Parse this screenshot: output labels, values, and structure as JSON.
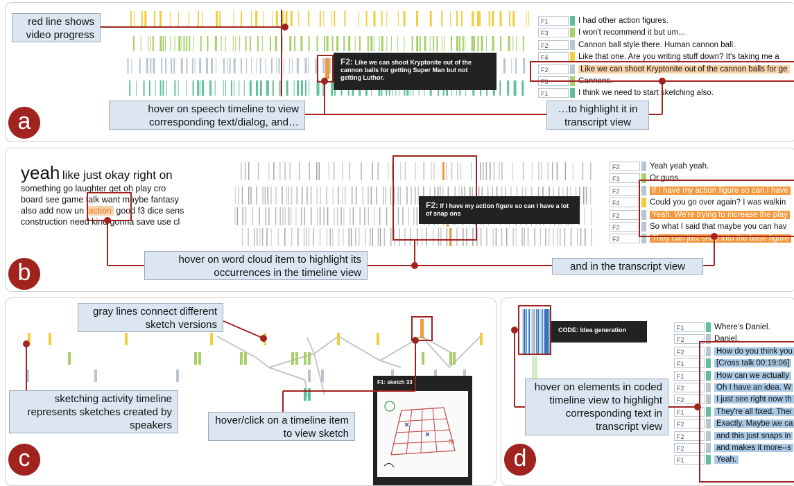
{
  "panel_a": {
    "badge": "a",
    "callout_progress": "red line shows video progress",
    "tooltip_speaker": "F2:",
    "tooltip_text": "Like we can shoot Kryptonite out of the cannon balls for getting Super Man but not getting Luthor.",
    "callout_hover": "hover on speech timeline to view corresponding text/dialog, and…",
    "callout_highlight": "…to highlight it in transcript view",
    "transcript": [
      {
        "speaker": "F1",
        "text": "I had other action figures."
      },
      {
        "speaker": "F3",
        "text": "I won't recommend it but um..."
      },
      {
        "speaker": "F2",
        "text": "Cannon ball style there. Human cannon ball."
      },
      {
        "speaker": "F4",
        "text": "Like that one. Are you writing stuff down? It's taking me a"
      },
      {
        "speaker": "F2",
        "text": "Like we can shoot Kryptonite out of the cannon balls for ge"
      },
      {
        "speaker": "F3",
        "text": "Cannons."
      },
      {
        "speaker": "F1",
        "text": "I think we need to start sketching also."
      }
    ]
  },
  "panel_b": {
    "badge": "b",
    "wordcloud_big": "yeah",
    "wordcloud_l1_rest": "like just okay right on",
    "wordcloud_l2": "something go laughter get oh play cro",
    "wordcloud_l3": "board see game talk want maybe fantasy",
    "wordcloud_l4_a": "also add now un",
    "wordcloud_l4_hl": "action",
    "wordcloud_l4_b": "good f3 dice sens",
    "wordcloud_l5": "construction need kind gonna save use cl",
    "tooltip_speaker": "F2:",
    "tooltip_text": "If I have my action figure so can I have a lot of snap ons",
    "callout_word": "hover on word cloud item to highlight its occurrences in the  timeline view",
    "callout_transcript": "and in the transcript view",
    "transcript": [
      {
        "speaker": "F2",
        "text": "Yeah yeah yeah."
      },
      {
        "speaker": "F3",
        "text": "Or guns."
      },
      {
        "speaker": "F2",
        "text": "If I have my action figure so can I have"
      },
      {
        "speaker": "F4",
        "text": "Could you go over again? I was walkin"
      },
      {
        "speaker": "F2",
        "text": "Yeah. We're trying to increase the play"
      },
      {
        "speaker": "F2",
        "text": "So what I said that maybe you can hav"
      },
      {
        "speaker": "F2",
        "text": "They can just snap into the base figure"
      }
    ]
  },
  "panel_c": {
    "badge": "c",
    "callout_gray": "gray lines connect different sketch versions",
    "callout_timeline": "sketching activity timeline represents sketches created by speakers",
    "callout_hover": "hover/click on a timeline item to view sketch",
    "sketch_title": "F1: sketch 33"
  },
  "panel_d": {
    "badge": "d",
    "tooltip_text": "CODE: Idea generation",
    "callout_hover": "hover on elements in coded timeline view to highlight corresponding text in transcript view",
    "transcript": [
      {
        "speaker": "F1",
        "text": "Where's Daniel."
      },
      {
        "speaker": "F2",
        "text": "Daniel."
      },
      {
        "speaker": "F2",
        "text": "How do you think you"
      },
      {
        "speaker": "F1",
        "text": "[Cross talk 00:19:06]"
      },
      {
        "speaker": "F1",
        "text": "How can we actually"
      },
      {
        "speaker": "F2",
        "text": "Oh I have an idea. W"
      },
      {
        "speaker": "F2",
        "text": "I just see right now th"
      },
      {
        "speaker": "F1",
        "text": "They're all fixed. Thei"
      },
      {
        "speaker": "F2",
        "text": "Exactly. Maybe we ca"
      },
      {
        "speaker": "F2",
        "text": "and this just snaps in"
      },
      {
        "speaker": "F2",
        "text": "and makes it more--s"
      },
      {
        "speaker": "F1",
        "text": "Yeah."
      }
    ]
  },
  "colors": {
    "red": "#a0231f",
    "orange": "#f5983d",
    "callout_bg": "#dce6f2",
    "F1": "#5fbf9a",
    "F2": "#b8c4d0",
    "F3": "#a8cf6a",
    "F4": "#f2cc3a"
  }
}
